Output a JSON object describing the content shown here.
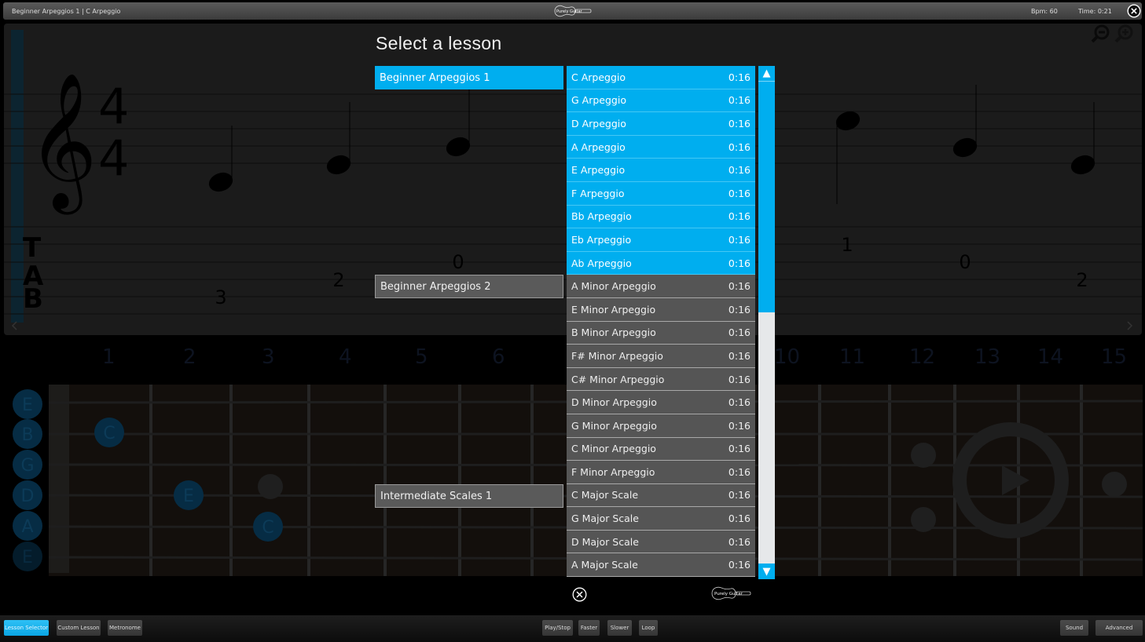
{
  "topbar": {
    "title": "Beginner Arpeggios 1 | C Arpeggio",
    "logo_text": "Purely Guitar",
    "bpm": "Bpm: 60",
    "time": "Time: 0:21",
    "close_icon": "close-circle-icon"
  },
  "notation": {
    "time_signature": [
      "4",
      "4"
    ],
    "tab_label": [
      "T",
      "A",
      "B"
    ],
    "tab_numbers": [
      "3",
      "2",
      "0",
      "1",
      "0",
      "2"
    ],
    "zoom_out_icon": "zoom-out-icon",
    "zoom_in_icon": "zoom-in-icon"
  },
  "fretboard": {
    "fret_numbers": [
      "1",
      "2",
      "3",
      "4",
      "5",
      "6",
      "10",
      "11",
      "12",
      "13",
      "14",
      "15"
    ],
    "strings": [
      "E",
      "B",
      "G",
      "D",
      "A",
      "E"
    ],
    "notes": [
      {
        "label": "C",
        "string": "B",
        "fret": 1
      },
      {
        "label": "E",
        "string": "D",
        "fret": 2
      },
      {
        "label": "C",
        "string": "A",
        "fret": 3
      }
    ],
    "play_overlay_icon": "play-circle-icon"
  },
  "modal": {
    "title": "Select a lesson",
    "categories": [
      {
        "label": "Beginner Arpeggios 1",
        "active": true
      },
      {
        "label": "Beginner Arpeggios 2",
        "active": false
      },
      {
        "label": "Intermediate Scales 1",
        "active": false
      }
    ],
    "lessons": [
      {
        "name": "C Arpeggio",
        "duration": "0:16",
        "group": 1
      },
      {
        "name": "G Arpeggio",
        "duration": "0:16",
        "group": 1
      },
      {
        "name": "D Arpeggio",
        "duration": "0:16",
        "group": 1
      },
      {
        "name": "A Arpeggio",
        "duration": "0:16",
        "group": 1
      },
      {
        "name": "E Arpeggio",
        "duration": "0:16",
        "group": 1
      },
      {
        "name": "F Arpeggio",
        "duration": "0:16",
        "group": 1
      },
      {
        "name": "Bb Arpeggio",
        "duration": "0:16",
        "group": 1
      },
      {
        "name": "Eb Arpeggio",
        "duration": "0:16",
        "group": 1
      },
      {
        "name": "Ab Arpeggio",
        "duration": "0:16",
        "group": 1
      },
      {
        "name": "A Minor Arpeggio",
        "duration": "0:16",
        "group": 2
      },
      {
        "name": "E Minor Arpeggio",
        "duration": "0:16",
        "group": 2
      },
      {
        "name": "B Minor Arpeggio",
        "duration": "0:16",
        "group": 2
      },
      {
        "name": "F# Minor Arpeggio",
        "duration": "0:16",
        "group": 2
      },
      {
        "name": "C# Minor Arpeggio",
        "duration": "0:16",
        "group": 2
      },
      {
        "name": "D Minor Arpeggio",
        "duration": "0:16",
        "group": 2
      },
      {
        "name": "G Minor Arpeggio",
        "duration": "0:16",
        "group": 2
      },
      {
        "name": "C Minor Arpeggio",
        "duration": "0:16",
        "group": 2
      },
      {
        "name": "F Minor Arpeggio",
        "duration": "0:16",
        "group": 2
      },
      {
        "name": "C Major Scale",
        "duration": "0:16",
        "group": 3
      },
      {
        "name": "G Major Scale",
        "duration": "0:16",
        "group": 3
      },
      {
        "name": "D Major Scale",
        "duration": "0:16",
        "group": 3
      },
      {
        "name": "A Major Scale",
        "duration": "0:16",
        "group": 3
      }
    ],
    "scroll_position_fraction": 0.48,
    "scroll_up_glyph": "▲",
    "scroll_down_glyph": "▼",
    "logo_text": "Purely Guitar"
  },
  "bottombar": {
    "left_buttons": [
      {
        "label": "Lesson Selector",
        "active": true
      },
      {
        "label": "Custom Lesson",
        "active": false
      },
      {
        "label": "Metronome",
        "active": false
      }
    ],
    "center_buttons": [
      {
        "label": "Play/Stop"
      },
      {
        "label": "Faster"
      },
      {
        "label": "Slower"
      },
      {
        "label": "Loop"
      }
    ],
    "right_buttons": [
      {
        "label": "Sound"
      },
      {
        "label": "Advanced"
      }
    ]
  },
  "colors": {
    "accent": "#00aeef",
    "list_grey": "#555555",
    "notation_bg": "#1b1b1b"
  }
}
